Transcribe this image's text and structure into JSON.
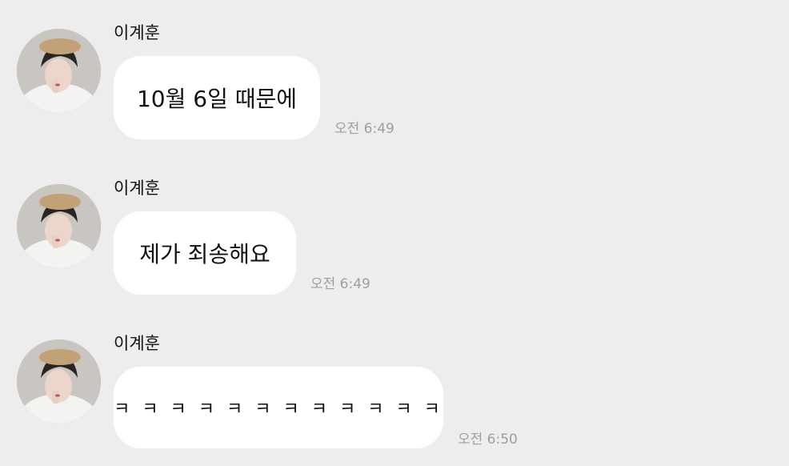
{
  "messages": [
    {
      "sender": "이계훈",
      "text": "10월 6일 때문에",
      "time": "오전 6:49"
    },
    {
      "sender": "이계훈",
      "text": "제가 죄송해요",
      "time": "오전 6:49"
    },
    {
      "sender": "이계훈",
      "text": "ㅋ ㅋ ㅋ ㅋ ㅋ ㅋ ㅋ ㅋ ㅋ ㅋ ㅋ ㅋ",
      "time": "오전 6:50"
    }
  ],
  "colors": {
    "background": "#ededed",
    "bubble": "#ffffff",
    "time": "#9e9e9e"
  }
}
